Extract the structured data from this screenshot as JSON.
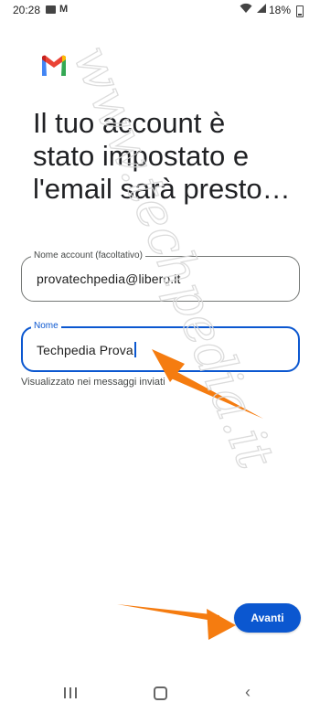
{
  "status_bar": {
    "time": "20:28",
    "battery": "18%",
    "icons": [
      "gallery-icon",
      "gmail-icon",
      "wifi-icon",
      "signal-icon",
      "battery-icon"
    ]
  },
  "logo": "gmail-logo",
  "headline": "Il tuo account è\nstato impostato e\nl'email sarà presto…",
  "account_field": {
    "label": "Nome account (facoltativo)",
    "value": "provatechpedia@libero.it"
  },
  "name_field": {
    "label": "Nome",
    "value": "Techpedia Prova",
    "helper": "Visualizzato nei messaggi inviati"
  },
  "next_button": {
    "label": "Avanti"
  },
  "nav_bar": {
    "icons": [
      "recents-icon",
      "home-icon",
      "back-icon"
    ]
  },
  "colors": {
    "accent": "#0b57d0",
    "annotation_arrow": "#f57c10",
    "text": "#202124"
  },
  "watermark": {
    "text": "www.techpedia.it"
  }
}
